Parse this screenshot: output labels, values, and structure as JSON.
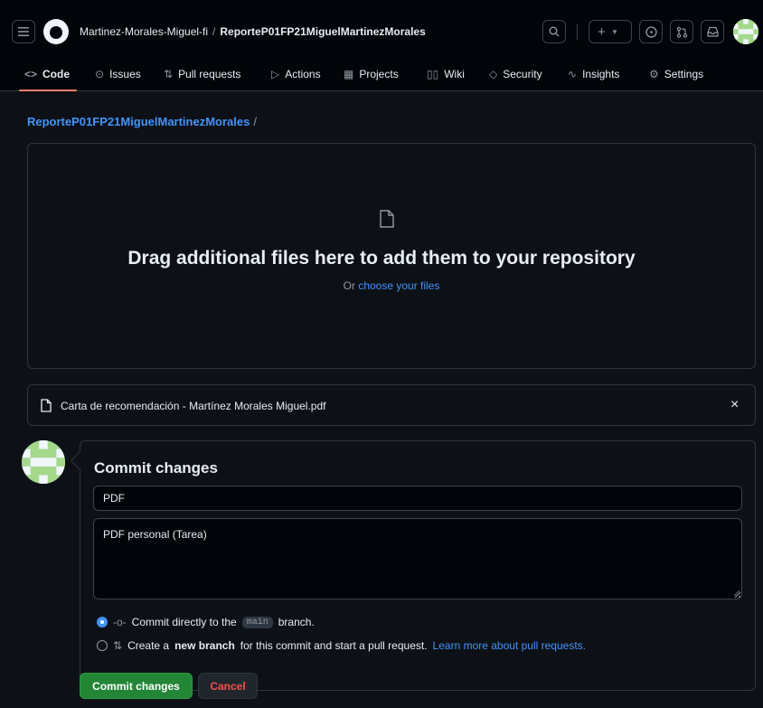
{
  "header": {
    "owner": "Martinez-Morales-Miguel-fi",
    "separator": "/",
    "repo": "ReporteP01FP21MiguelMartinezMorales",
    "plus": "+",
    "caret": "▾",
    "icons": [
      "menu-icon",
      "github-logo-icon",
      "search-icon",
      "plus-icon",
      "issue-icon",
      "pull-request-icon",
      "inbox-icon"
    ]
  },
  "tabs": [
    {
      "label": "Code",
      "icon": "<>"
    },
    {
      "label": "Issues",
      "icon": "⊙"
    },
    {
      "label": "Pull requests",
      "icon": "⇅"
    },
    {
      "label": "Actions",
      "icon": "▷"
    },
    {
      "label": "Projects",
      "icon": "▦"
    },
    {
      "label": "Wiki",
      "icon": "▯▯"
    },
    {
      "label": "Security",
      "icon": "◇"
    },
    {
      "label": "Insights",
      "icon": "∿"
    },
    {
      "label": "Settings",
      "icon": "⚙"
    }
  ],
  "path": {
    "repo": "ReporteP01FP21MiguelMartinezMorales",
    "slash": "/"
  },
  "dropzone": {
    "title": "Drag additional files here to add them to your repository",
    "or": "Or",
    "choose": "choose your files"
  },
  "file": {
    "name": "Carta de recomendación - Martínez Morales Miguel.pdf",
    "close": "×"
  },
  "commit": {
    "title": "Commit changes",
    "summary": "PDF",
    "description": "PDF personal (Tarea)",
    "option1": {
      "prefix": "Commit directly to the",
      "branch": "main",
      "suffix": "branch."
    },
    "option2": {
      "prefix": "Create a",
      "bold": "new branch",
      "suffix": "for this commit and start a pull request.",
      "link": "Learn more about pull requests."
    },
    "commit_button": "Commit changes",
    "cancel_button": "Cancel"
  },
  "colors": {
    "background": "#0d1117",
    "accent_link": "#4493f8",
    "commit_green": "#238636",
    "cancel_red": "#f85149",
    "tab_underline": "#f78166"
  }
}
